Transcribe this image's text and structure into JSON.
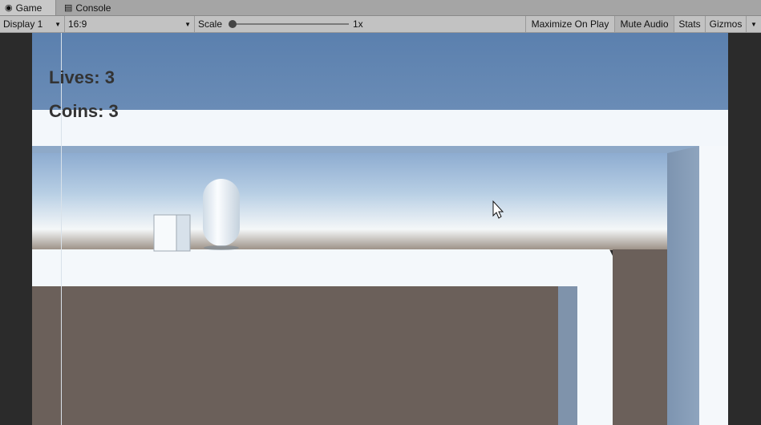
{
  "tabs": [
    {
      "label": "Game",
      "icon": "gamepad-icon",
      "active": true
    },
    {
      "label": "Console",
      "icon": "console-icon",
      "active": false
    }
  ],
  "toolbar": {
    "display": "Display 1",
    "aspect": "16:9",
    "scale_label": "Scale",
    "scale_value": "1x",
    "scale_level": 0,
    "maximize_on_play": "Maximize On Play",
    "mute_audio": "Mute Audio",
    "stats": "Stats",
    "gizmos": "Gizmos"
  },
  "hud": {
    "lives": "Lives: 3",
    "coins": "Coins: 3"
  },
  "colors": {
    "sky_top": "#5b7fae",
    "platform": "#f4f8fb",
    "floor": "#6b605a",
    "panel": "#c2c2c2"
  }
}
